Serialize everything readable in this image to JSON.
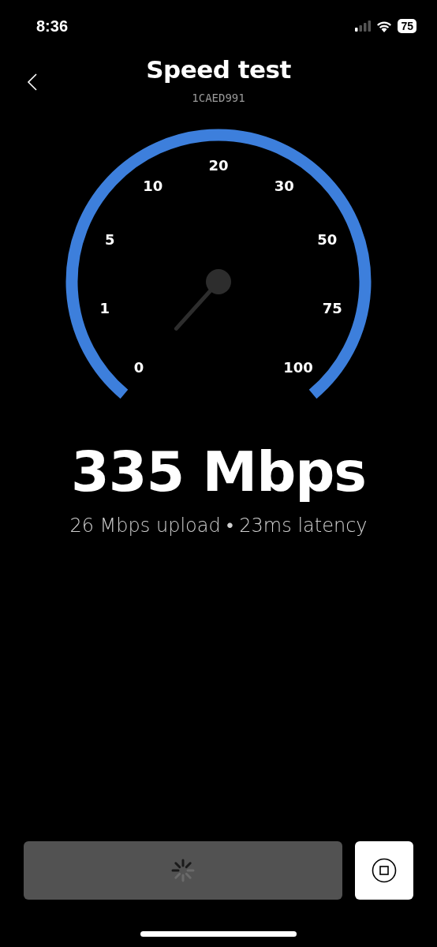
{
  "status_bar": {
    "time": "8:36",
    "battery": "75"
  },
  "header": {
    "title": "Speed test",
    "subtitle": "1CAED991"
  },
  "gauge": {
    "labels": [
      "0",
      "1",
      "5",
      "10",
      "20",
      "30",
      "50",
      "75",
      "100"
    ]
  },
  "result": {
    "speed": "335 Mbps",
    "details": "26 Mbps upload • 23ms latency"
  },
  "controls": {
    "start_button": {
      "disabled": true
    }
  }
}
